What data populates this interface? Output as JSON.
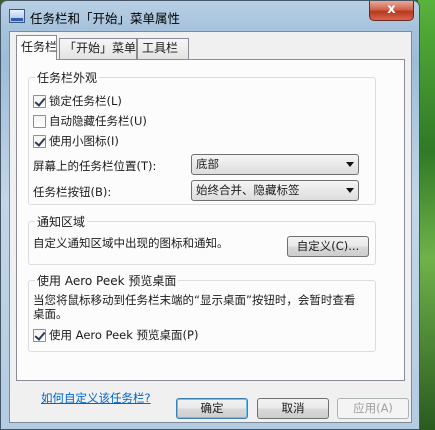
{
  "window": {
    "title": "任务栏和「开始」菜单属性",
    "close_label": "x"
  },
  "tabs": [
    {
      "label": "任务栏"
    },
    {
      "label": "「开始」菜单"
    },
    {
      "label": "工具栏"
    }
  ],
  "appearance": {
    "legend": "任务栏外观",
    "lock_taskbar": {
      "label": "锁定任务栏(L)",
      "checked": true
    },
    "auto_hide": {
      "label": "自动隐藏任务栏(U)",
      "checked": false
    },
    "small_icons": {
      "label": "使用小图标(I)",
      "checked": true
    },
    "location_label": "屏幕上的任务栏位置(T):",
    "location_value": "底部",
    "buttons_label": "任务栏按钮(B):",
    "buttons_value": "始终合并、隐藏标签"
  },
  "notification": {
    "legend": "通知区域",
    "desc": "自定义通知区域中出现的图标和通知。",
    "customize_button": "自定义(C)..."
  },
  "aero_peek": {
    "legend": "使用 Aero Peek 预览桌面",
    "desc": "当您将鼠标移动到任务栏末端的“显示桌面”按钮时，会暂时查看桌面。",
    "checkbox": {
      "label": "使用 Aero Peek 预览桌面(P)",
      "checked": true
    }
  },
  "help_link": "如何自定义该任务栏?",
  "footer": {
    "ok": "确定",
    "cancel": "取消",
    "apply": "应用(A)"
  }
}
